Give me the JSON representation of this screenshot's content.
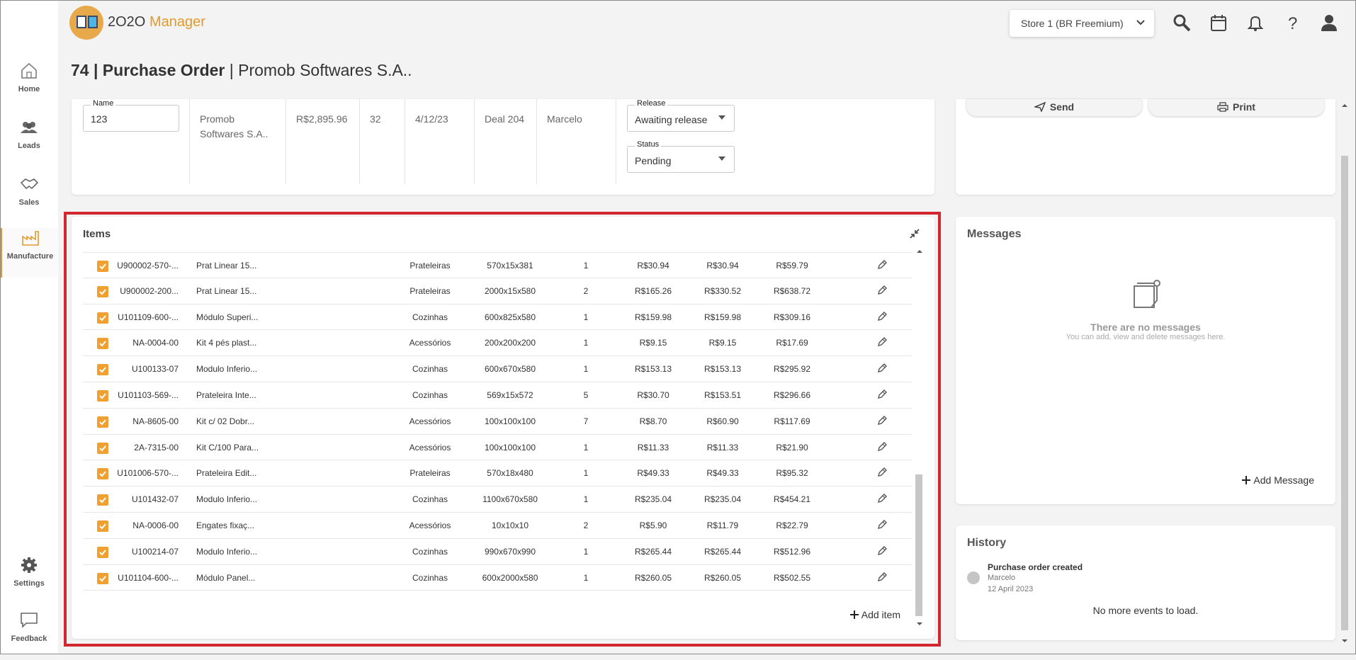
{
  "app": {
    "logo_prefix": "2",
    "logo_brand": "O2O",
    "logo_suffix": "Manager"
  },
  "sidebar": {
    "items": [
      {
        "label": "Home",
        "icon": "home-icon"
      },
      {
        "label": "Leads",
        "icon": "people-icon"
      },
      {
        "label": "Sales",
        "icon": "handshake-icon"
      },
      {
        "label": "Manufacture",
        "icon": "factory-icon"
      },
      {
        "label": "Settings",
        "icon": "gear-icon"
      },
      {
        "label": "Feedback",
        "icon": "chat-icon"
      }
    ]
  },
  "header": {
    "store": "Store 1 (BR Freemium)",
    "icons": [
      "search-icon",
      "calendar-icon",
      "bell-icon",
      "help-icon",
      "user-icon"
    ]
  },
  "page": {
    "title_number": "74 | Purchase Order",
    "title_supplier": " | Promob Softwares S.A.."
  },
  "order": {
    "name_label": "Name",
    "name_value": "123",
    "supplier_line1": "Promob",
    "supplier_line2": "Softwares S.A..",
    "total": "R$2,895.96",
    "count": "32",
    "date": "4/12/23",
    "deal": "Deal 204",
    "user": "Marcelo",
    "release_label": "Release",
    "release_value": "Awaiting release",
    "status_label": "Status",
    "status_value": "Pending"
  },
  "actions": {
    "send": "Send",
    "print": "Print"
  },
  "items": {
    "title": "Items",
    "add_label": "Add item",
    "rows": [
      {
        "code": "U900002-570-...",
        "desc": "Prat Linear 15...",
        "cat": "Prateleiras",
        "dim": "570x15x381",
        "qty": "1",
        "p1": "R$30.94",
        "p2": "R$30.94",
        "p3": "R$59.79"
      },
      {
        "code": "U900002-200...",
        "desc": "Prat Linear 15...",
        "cat": "Prateleiras",
        "dim": "2000x15x580",
        "qty": "2",
        "p1": "R$165.26",
        "p2": "R$330.52",
        "p3": "R$638.72"
      },
      {
        "code": "U101109-600-...",
        "desc": "Módulo Superi...",
        "cat": "Cozinhas",
        "dim": "600x825x580",
        "qty": "1",
        "p1": "R$159.98",
        "p2": "R$159.98",
        "p3": "R$309.16"
      },
      {
        "code": "NA-0004-00",
        "desc": "Kit 4 pés plast...",
        "cat": "Acessórios",
        "dim": "200x200x200",
        "qty": "1",
        "p1": "R$9.15",
        "p2": "R$9.15",
        "p3": "R$17.69"
      },
      {
        "code": "U100133-07",
        "desc": "Modulo Inferio...",
        "cat": "Cozinhas",
        "dim": "600x670x580",
        "qty": "1",
        "p1": "R$153.13",
        "p2": "R$153.13",
        "p3": "R$295.92"
      },
      {
        "code": "U101103-569-...",
        "desc": "Prateleira Inte...",
        "cat": "Cozinhas",
        "dim": "569x15x572",
        "qty": "5",
        "p1": "R$30.70",
        "p2": "R$153.51",
        "p3": "R$296.66"
      },
      {
        "code": "NA-8605-00",
        "desc": "Kit c/ 02 Dobr...",
        "cat": "Acessórios",
        "dim": "100x100x100",
        "qty": "7",
        "p1": "R$8.70",
        "p2": "R$60.90",
        "p3": "R$117.69"
      },
      {
        "code": "2A-7315-00",
        "desc": "Kit C/100 Para...",
        "cat": "Acessórios",
        "dim": "100x100x100",
        "qty": "1",
        "p1": "R$11.33",
        "p2": "R$11.33",
        "p3": "R$21.90"
      },
      {
        "code": "U101006-570-...",
        "desc": "Prateleira Edit...",
        "cat": "Prateleiras",
        "dim": "570x18x480",
        "qty": "1",
        "p1": "R$49.33",
        "p2": "R$49.33",
        "p3": "R$95.32"
      },
      {
        "code": "U101432-07",
        "desc": "Modulo Inferio...",
        "cat": "Cozinhas",
        "dim": "1100x670x580",
        "qty": "1",
        "p1": "R$235.04",
        "p2": "R$235.04",
        "p3": "R$454.21"
      },
      {
        "code": "NA-0006-00",
        "desc": "Engates fixaç...",
        "cat": "Acessórios",
        "dim": "10x10x10",
        "qty": "2",
        "p1": "R$5.90",
        "p2": "R$11.79",
        "p3": "R$22.79"
      },
      {
        "code": "U100214-07",
        "desc": "Modulo Inferio...",
        "cat": "Cozinhas",
        "dim": "990x670x990",
        "qty": "1",
        "p1": "R$265.44",
        "p2": "R$265.44",
        "p3": "R$512.96"
      },
      {
        "code": "U101104-600-...",
        "desc": "Módulo Panel...",
        "cat": "Cozinhas",
        "dim": "600x2000x580",
        "qty": "1",
        "p1": "R$260.05",
        "p2": "R$260.05",
        "p3": "R$502.55"
      }
    ]
  },
  "messages": {
    "title": "Messages",
    "empty_title": "There are no messages",
    "empty_sub": "You can add, view and delete messages here.",
    "add_label": "Add Message"
  },
  "history": {
    "title": "History",
    "event_title": "Purchase order created",
    "event_user": "Marcelo",
    "event_date": "12 April 2023",
    "no_more": "No more events to load."
  },
  "colors": {
    "accent": "#f0a030",
    "highlight": "#d4262f"
  }
}
